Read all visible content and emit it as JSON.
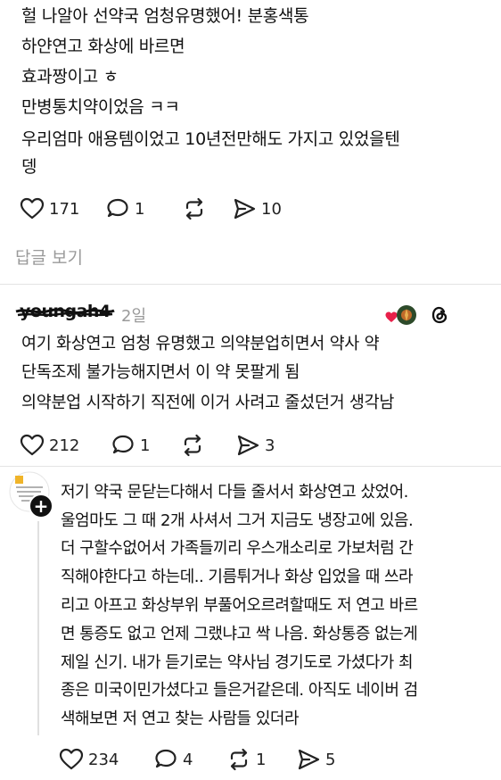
{
  "comment1": {
    "lines": [
      "헐 나알아 선약국 엄청유명했어! 분홍색통",
      "하얀연고 화상에 바르면",
      "효과짱이고 ㅎ",
      "만병통치약이었음 ㅋㅋ",
      "우리엄마 애용템이었고 10년전만해도 가지고 있었을텐",
      "뎅"
    ],
    "likes": "171",
    "replies": "1",
    "reposts": "",
    "shares": "10"
  },
  "view_replies": "답글 보기",
  "comment2": {
    "username": "youngah4",
    "time": "2일",
    "lines": [
      "여기 화상연고 엄청 유명했고 의약분업히면서 약사 약",
      "단독조제 불가능해지면서 이 약 못팔게 됨",
      "의약분업 시작하기 직전에 이거 사려고 줄섰던거 생각남"
    ],
    "likes": "212",
    "replies": "1",
    "reposts": "",
    "shares": "3"
  },
  "comment3": {
    "lines": [
      "저기  약국 문닫는다해서 다들 줄서서 화상연고 샀었어.",
      "울엄마도 그 때 2개 사셔서 그거 지금도 냉장고에 있음.",
      "더 구할수없어서 가족들끼리 우스개소리로 가보처럼 간",
      "직해야한다고 하는데.. 기름튀거나 화상 입었을 때 쓰라",
      "리고 아프고 화상부위 부풀어오르려할때도 저 연고 바르",
      "면 통증도 없고 언제 그랬냐고 싹 나음. 화상통증 없는게",
      "제일 신기.  내가 듣기로는 약사님 경기도로 가셨다가 최",
      "종은 미국이민가셨다고 들은거같은데. 아직도 네이버 검",
      "색해보면 저 연고 찾는 사람들 있더라"
    ],
    "likes": "234",
    "replies": "4",
    "reposts": "1",
    "shares": "5"
  },
  "colors": {
    "text": "#111111",
    "muted": "#9a9a9a",
    "heart": "#e8204a",
    "divider": "#e4e4e4"
  },
  "icons": [
    "heart-icon",
    "comment-icon",
    "repost-icon",
    "share-icon",
    "threads-icon",
    "plus-icon"
  ]
}
